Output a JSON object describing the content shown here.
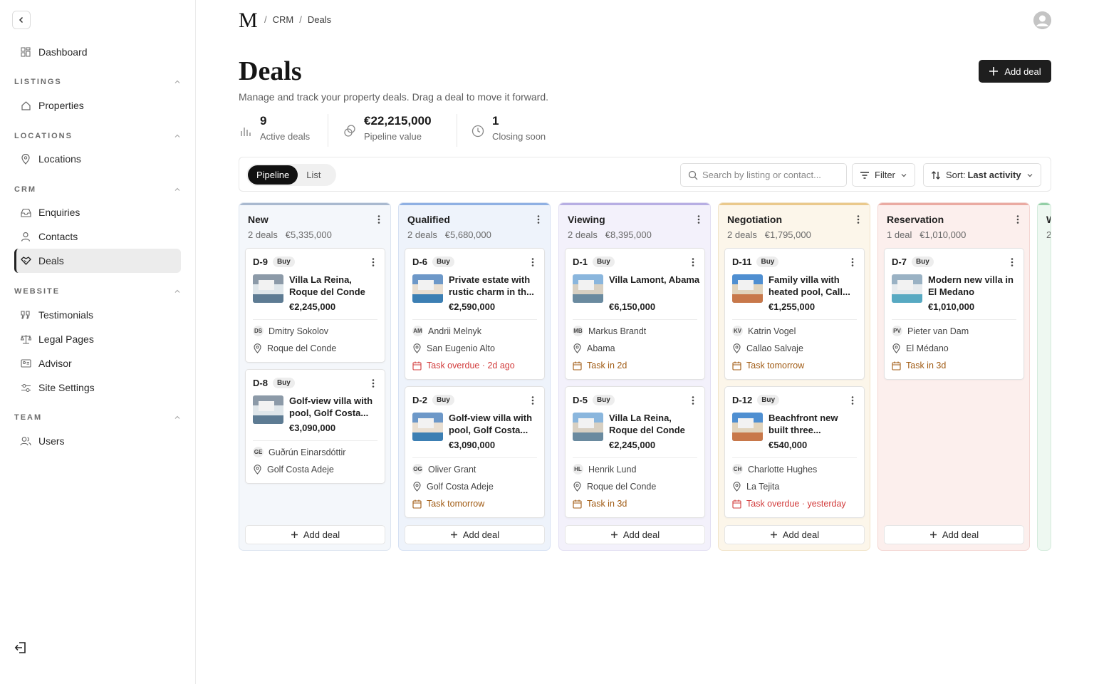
{
  "sidebar": {
    "items": [
      {
        "label": "Dashboard",
        "icon": "dashboard-icon"
      },
      {
        "label": "Properties",
        "icon": "home-icon"
      },
      {
        "label": "Locations",
        "icon": "pin-icon"
      },
      {
        "label": "Enquiries",
        "icon": "inbox-icon"
      },
      {
        "label": "Contacts",
        "icon": "user-icon"
      },
      {
        "label": "Deals",
        "icon": "handshake-icon"
      },
      {
        "label": "Testimonials",
        "icon": "quote-icon"
      },
      {
        "label": "Legal Pages",
        "icon": "scales-icon"
      },
      {
        "label": "Advisor",
        "icon": "id-card-icon"
      },
      {
        "label": "Site Settings",
        "icon": "sliders-icon"
      },
      {
        "label": "Users",
        "icon": "users-icon"
      }
    ],
    "sections": [
      "LISTINGS",
      "LOCATIONS",
      "CRM",
      "WEBSITE",
      "TEAM"
    ],
    "active": "Deals"
  },
  "header": {
    "logo": "M",
    "breadcrumb": [
      "CRM",
      "Deals"
    ],
    "separator": "/"
  },
  "page": {
    "title": "Deals",
    "subtitle": "Manage and track your property deals. Drag a deal to move it forward.",
    "add_button": "Add deal"
  },
  "stats": [
    {
      "value": "9",
      "label": "Active deals"
    },
    {
      "value": "€22,215,000",
      "label": "Pipeline value"
    },
    {
      "value": "1",
      "label": "Closing soon"
    }
  ],
  "toolbar": {
    "view_options": [
      "Pipeline",
      "List"
    ],
    "view_selected": "Pipeline",
    "search_placeholder": "Search by listing or contact...",
    "filter_label": "Filter",
    "sort_prefix": "Sort:",
    "sort_value": "Last activity"
  },
  "columns": [
    {
      "title": "New",
      "count": "2 deals",
      "value": "€5,335,000",
      "add_label": "Add deal",
      "colors": {
        "border": "#dde5f0",
        "bg": "#f4f7fb",
        "bar": "#a9b9cf"
      },
      "cards": [
        {
          "id": "D-9",
          "type": "Buy",
          "title": "Villa La Reina, Roque del Conde",
          "price": "€2,245,000",
          "initials": "DS",
          "contact": "Dmitry Sokolov",
          "location": "Roque del Conde"
        },
        {
          "id": "D-8",
          "type": "Buy",
          "title": "Golf-view villa with pool, Golf Costa...",
          "price": "€3,090,000",
          "initials": "GE",
          "contact": "Guðrún Einarsdóttir",
          "location": "Golf Costa Adeje"
        }
      ]
    },
    {
      "title": "Qualified",
      "count": "2 deals",
      "value": "€5,680,000",
      "add_label": "Add deal",
      "colors": {
        "border": "#d6e1f3",
        "bg": "#eef3fb",
        "bar": "#8fb0e3"
      },
      "cards": [
        {
          "id": "D-6",
          "type": "Buy",
          "title": "Private estate with rustic charm in th...",
          "price": "€2,590,000",
          "initials": "AM",
          "contact": "Andrii Melnyk",
          "location": "San Eugenio Alto",
          "task": "Task overdue · 2d ago",
          "overdue": true
        },
        {
          "id": "D-2",
          "type": "Buy",
          "title": "Golf-view villa with pool, Golf Costa...",
          "price": "€3,090,000",
          "initials": "OG",
          "contact": "Oliver Grant",
          "location": "Golf Costa Adeje",
          "task": "Task tomorrow",
          "overdue": false
        }
      ]
    },
    {
      "title": "Viewing",
      "count": "2 deals",
      "value": "€8,395,000",
      "add_label": "Add deal",
      "colors": {
        "border": "#e2dff2",
        "bg": "#f3f1fb",
        "bar": "#b7aee3"
      },
      "cards": [
        {
          "id": "D-1",
          "type": "Buy",
          "title": "Villa Lamont, Abama",
          "price": "€6,150,000",
          "initials": "MB",
          "contact": "Markus Brandt",
          "location": "Abama",
          "task": "Task in 2d",
          "overdue": false
        },
        {
          "id": "D-5",
          "type": "Buy",
          "title": "Villa La Reina, Roque del Conde",
          "price": "€2,245,000",
          "initials": "HL",
          "contact": "Henrik Lund",
          "location": "Roque del Conde",
          "task": "Task in 3d",
          "overdue": false
        }
      ]
    },
    {
      "title": "Negotiation",
      "count": "2 deals",
      "value": "€1,795,000",
      "add_label": "Add deal",
      "colors": {
        "border": "#f1e3c8",
        "bg": "#fcf6ea",
        "bar": "#eac98c"
      },
      "cards": [
        {
          "id": "D-11",
          "type": "Buy",
          "title": "Family villa with heated pool, Call...",
          "price": "€1,255,000",
          "initials": "KV",
          "contact": "Katrin Vogel",
          "location": "Callao Salvaje",
          "task": "Task tomorrow",
          "overdue": false
        },
        {
          "id": "D-12",
          "type": "Buy",
          "title": "Beachfront new built three...",
          "price": "€540,000",
          "initials": "CH",
          "contact": "Charlotte Hughes",
          "location": "La Tejita",
          "task": "Task overdue · yesterday",
          "overdue": true
        }
      ]
    },
    {
      "title": "Reservation",
      "count": "1 deal",
      "value": "€1,010,000",
      "add_label": "Add deal",
      "colors": {
        "border": "#f3d6d2",
        "bg": "#fcefed",
        "bar": "#eaaaa2"
      },
      "cards": [
        {
          "id": "D-7",
          "type": "Buy",
          "title": "Modern new villa in El Medano",
          "price": "€1,010,000",
          "initials": "PV",
          "contact": "Pieter van Dam",
          "location": "El Médano",
          "task": "Task in 3d",
          "overdue": false
        }
      ]
    },
    {
      "title": "W",
      "count": "2",
      "value": "",
      "add_label": "",
      "colors": {
        "border": "#d4ebdc",
        "bg": "#eef8f1",
        "bar": "#93cfa6"
      },
      "cards": []
    }
  ]
}
